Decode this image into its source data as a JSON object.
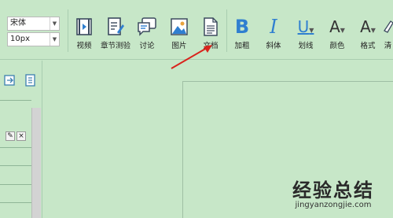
{
  "toolbar": {
    "font_family": "宋体",
    "font_size": "10px",
    "buttons": [
      {
        "label": "视频",
        "icon": "video-icon"
      },
      {
        "label": "章节测验",
        "icon": "quiz-icon"
      },
      {
        "label": "讨论",
        "icon": "discussion-icon"
      },
      {
        "label": "图片",
        "icon": "image-icon"
      },
      {
        "label": "文档",
        "icon": "document-icon"
      }
    ],
    "format_buttons": [
      {
        "label": "加粗",
        "glyph": "B"
      },
      {
        "label": "斜体",
        "glyph": "I"
      },
      {
        "label": "划线",
        "glyph": "U"
      },
      {
        "label": "颜色",
        "glyph": "A"
      },
      {
        "label": "格式",
        "glyph": "A"
      }
    ],
    "clear_label": "清"
  },
  "panel": {
    "edit_glyph": "✎",
    "close_glyph": "×"
  },
  "watermark": {
    "main": "经验总结",
    "sub": "jingyanzongjie.com"
  },
  "colors": {
    "background": "#c7e7c8",
    "accent": "#2f7fd0",
    "arrow": "#d9231c"
  }
}
